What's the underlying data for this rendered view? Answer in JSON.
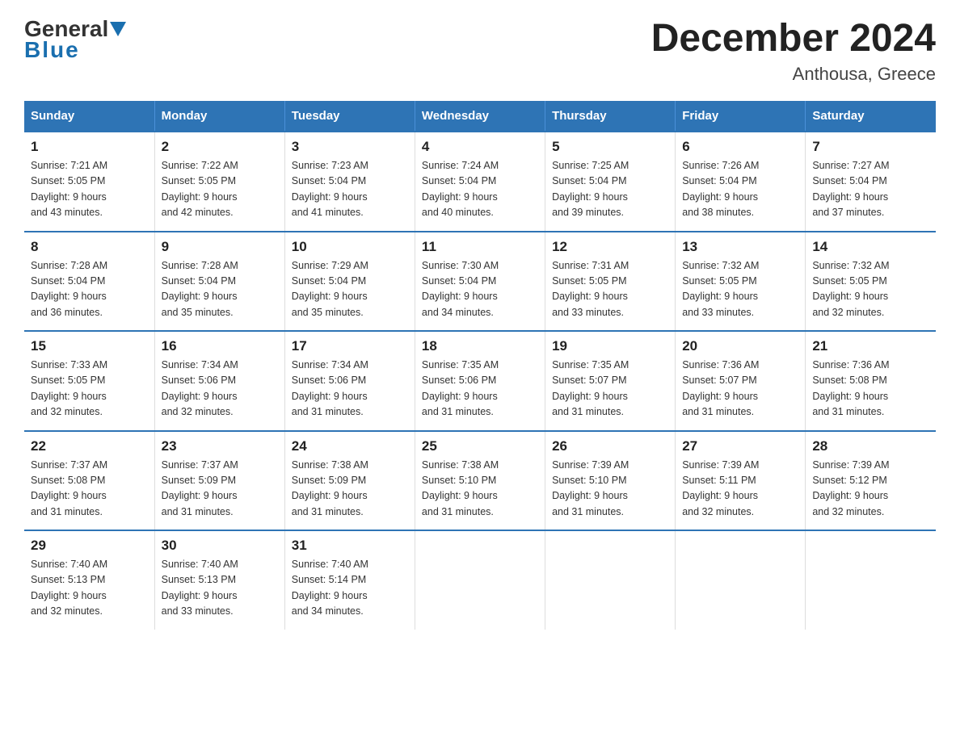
{
  "logo": {
    "general": "General",
    "blue": "Blue"
  },
  "header": {
    "title": "December 2024",
    "location": "Anthousa, Greece"
  },
  "weekdays": [
    "Sunday",
    "Monday",
    "Tuesday",
    "Wednesday",
    "Thursday",
    "Friday",
    "Saturday"
  ],
  "weeks": [
    [
      {
        "day": "1",
        "sunrise": "7:21 AM",
        "sunset": "5:05 PM",
        "daylight": "9 hours and 43 minutes."
      },
      {
        "day": "2",
        "sunrise": "7:22 AM",
        "sunset": "5:05 PM",
        "daylight": "9 hours and 42 minutes."
      },
      {
        "day": "3",
        "sunrise": "7:23 AM",
        "sunset": "5:04 PM",
        "daylight": "9 hours and 41 minutes."
      },
      {
        "day": "4",
        "sunrise": "7:24 AM",
        "sunset": "5:04 PM",
        "daylight": "9 hours and 40 minutes."
      },
      {
        "day": "5",
        "sunrise": "7:25 AM",
        "sunset": "5:04 PM",
        "daylight": "9 hours and 39 minutes."
      },
      {
        "day": "6",
        "sunrise": "7:26 AM",
        "sunset": "5:04 PM",
        "daylight": "9 hours and 38 minutes."
      },
      {
        "day": "7",
        "sunrise": "7:27 AM",
        "sunset": "5:04 PM",
        "daylight": "9 hours and 37 minutes."
      }
    ],
    [
      {
        "day": "8",
        "sunrise": "7:28 AM",
        "sunset": "5:04 PM",
        "daylight": "9 hours and 36 minutes."
      },
      {
        "day": "9",
        "sunrise": "7:28 AM",
        "sunset": "5:04 PM",
        "daylight": "9 hours and 35 minutes."
      },
      {
        "day": "10",
        "sunrise": "7:29 AM",
        "sunset": "5:04 PM",
        "daylight": "9 hours and 35 minutes."
      },
      {
        "day": "11",
        "sunrise": "7:30 AM",
        "sunset": "5:04 PM",
        "daylight": "9 hours and 34 minutes."
      },
      {
        "day": "12",
        "sunrise": "7:31 AM",
        "sunset": "5:05 PM",
        "daylight": "9 hours and 33 minutes."
      },
      {
        "day": "13",
        "sunrise": "7:32 AM",
        "sunset": "5:05 PM",
        "daylight": "9 hours and 33 minutes."
      },
      {
        "day": "14",
        "sunrise": "7:32 AM",
        "sunset": "5:05 PM",
        "daylight": "9 hours and 32 minutes."
      }
    ],
    [
      {
        "day": "15",
        "sunrise": "7:33 AM",
        "sunset": "5:05 PM",
        "daylight": "9 hours and 32 minutes."
      },
      {
        "day": "16",
        "sunrise": "7:34 AM",
        "sunset": "5:06 PM",
        "daylight": "9 hours and 32 minutes."
      },
      {
        "day": "17",
        "sunrise": "7:34 AM",
        "sunset": "5:06 PM",
        "daylight": "9 hours and 31 minutes."
      },
      {
        "day": "18",
        "sunrise": "7:35 AM",
        "sunset": "5:06 PM",
        "daylight": "9 hours and 31 minutes."
      },
      {
        "day": "19",
        "sunrise": "7:35 AM",
        "sunset": "5:07 PM",
        "daylight": "9 hours and 31 minutes."
      },
      {
        "day": "20",
        "sunrise": "7:36 AM",
        "sunset": "5:07 PM",
        "daylight": "9 hours and 31 minutes."
      },
      {
        "day": "21",
        "sunrise": "7:36 AM",
        "sunset": "5:08 PM",
        "daylight": "9 hours and 31 minutes."
      }
    ],
    [
      {
        "day": "22",
        "sunrise": "7:37 AM",
        "sunset": "5:08 PM",
        "daylight": "9 hours and 31 minutes."
      },
      {
        "day": "23",
        "sunrise": "7:37 AM",
        "sunset": "5:09 PM",
        "daylight": "9 hours and 31 minutes."
      },
      {
        "day": "24",
        "sunrise": "7:38 AM",
        "sunset": "5:09 PM",
        "daylight": "9 hours and 31 minutes."
      },
      {
        "day": "25",
        "sunrise": "7:38 AM",
        "sunset": "5:10 PM",
        "daylight": "9 hours and 31 minutes."
      },
      {
        "day": "26",
        "sunrise": "7:39 AM",
        "sunset": "5:10 PM",
        "daylight": "9 hours and 31 minutes."
      },
      {
        "day": "27",
        "sunrise": "7:39 AM",
        "sunset": "5:11 PM",
        "daylight": "9 hours and 32 minutes."
      },
      {
        "day": "28",
        "sunrise": "7:39 AM",
        "sunset": "5:12 PM",
        "daylight": "9 hours and 32 minutes."
      }
    ],
    [
      {
        "day": "29",
        "sunrise": "7:40 AM",
        "sunset": "5:13 PM",
        "daylight": "9 hours and 32 minutes."
      },
      {
        "day": "30",
        "sunrise": "7:40 AM",
        "sunset": "5:13 PM",
        "daylight": "9 hours and 33 minutes."
      },
      {
        "day": "31",
        "sunrise": "7:40 AM",
        "sunset": "5:14 PM",
        "daylight": "9 hours and 34 minutes."
      },
      null,
      null,
      null,
      null
    ]
  ],
  "labels": {
    "sunrise": "Sunrise:",
    "sunset": "Sunset:",
    "daylight": "Daylight:"
  }
}
